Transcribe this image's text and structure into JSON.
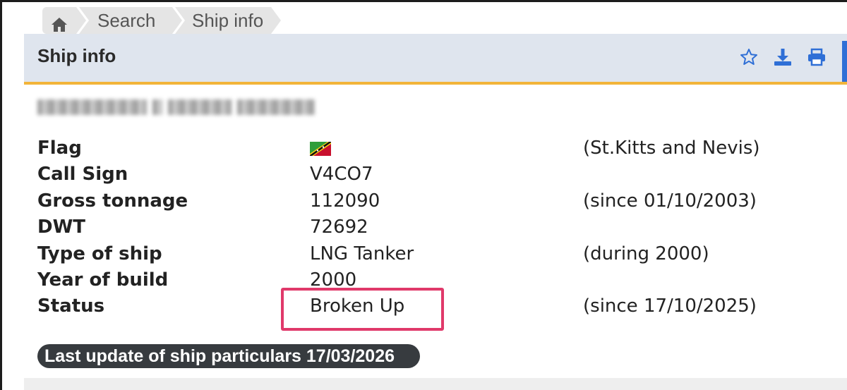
{
  "breadcrumb": {
    "home_icon": "home-icon",
    "items": [
      "Search",
      "Ship info"
    ]
  },
  "header": {
    "title": "Ship info",
    "icons": [
      "star-icon",
      "download-icon",
      "print-icon"
    ],
    "accent_color": "#2f6fd6",
    "underline_color": "#f2b43a"
  },
  "ship": {
    "flag": {
      "label": "Flag",
      "icon": "st-kitts-and-nevis-flag-icon",
      "note": "(St.Kitts and Nevis)"
    },
    "call_sign": {
      "label": "Call Sign",
      "value": "V4CO7"
    },
    "gross_tonnage": {
      "label": "Gross tonnage",
      "value": "112090",
      "note": "(since 01/10/2003)"
    },
    "dwt": {
      "label": "DWT",
      "value": "72692"
    },
    "type": {
      "label": "Type of ship",
      "value": "LNG Tanker",
      "note": "(during 2000)"
    },
    "year_built": {
      "label": "Year of build",
      "value": "2000"
    },
    "status": {
      "label": "Status",
      "value": "Broken Up",
      "note": "(since 17/10/2025)",
      "highlight_color": "#e0396a"
    }
  },
  "last_update": "Last update of ship particulars 17/03/2026"
}
